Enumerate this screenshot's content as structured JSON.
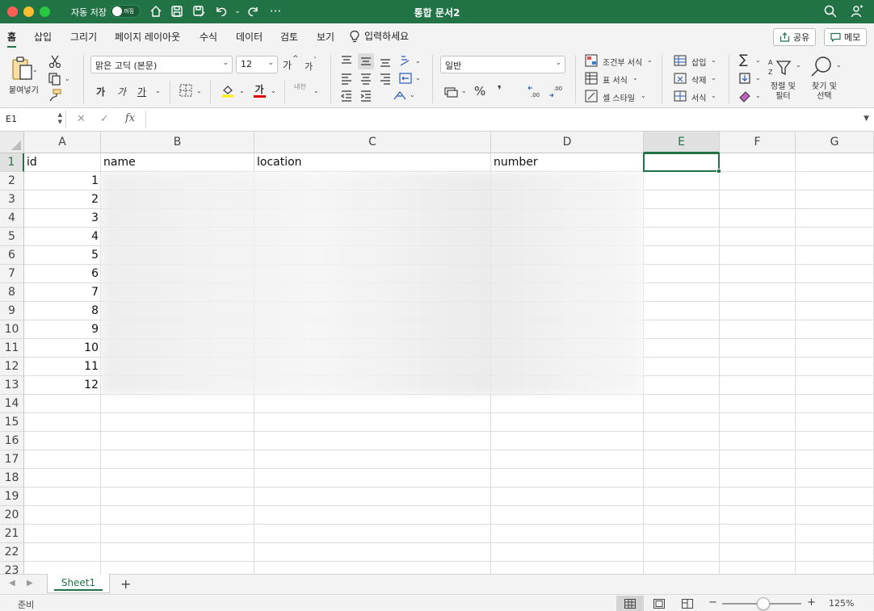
{
  "window": {
    "title": "통합 문서2",
    "autosave_label": "자동 저장",
    "autosave_state": "꺼짐"
  },
  "tabs": [
    "홈",
    "삽입",
    "그리기",
    "페이지 레이아웃",
    "수식",
    "데이터",
    "검토",
    "보기"
  ],
  "tell_me": "입력하세요",
  "share_label": "공유",
  "memo_label": "메모",
  "ribbon": {
    "paste_label": "붙여넣기",
    "font_name": "맑은 고딕 (본문)",
    "font_size": "12",
    "grow_font": "가",
    "shrink_font": "가",
    "bold": "가",
    "italic": "가",
    "underline": "가",
    "font_color_glyph": "가",
    "phonetic": "내천",
    "number_format": "일반",
    "percent": "%",
    "comma": "❜",
    "conditional_format": "조건부 서식",
    "format_as_table": "표 서식",
    "cell_styles": "셀 스타일",
    "insert": "삽입",
    "delete": "삭제",
    "format": "서식",
    "sort_filter": "정렬 및\n필터",
    "find_select": "찾기 및\n선택",
    "colors": {
      "font_color": "#e00000",
      "highlight": "#ffee00",
      "accent": "#217346"
    }
  },
  "formula_bar": {
    "name_box": "E1",
    "fx": "fx",
    "content": ""
  },
  "grid": {
    "columns": [
      "A",
      "B",
      "C",
      "D",
      "E",
      "F",
      "G"
    ],
    "rows": [
      "1",
      "2",
      "3",
      "4",
      "5",
      "6",
      "7",
      "8",
      "9",
      "10",
      "11",
      "12",
      "13",
      "14",
      "15",
      "16",
      "17",
      "18",
      "19",
      "20",
      "21",
      "22",
      "23"
    ],
    "header_row": [
      "id",
      "name",
      "location",
      "number"
    ],
    "id_values": [
      "1",
      "2",
      "3",
      "4",
      "5",
      "6",
      "7",
      "8",
      "9",
      "10",
      "11",
      "12"
    ],
    "selected_cell": "E1"
  },
  "sheet_tabs": [
    "Sheet1"
  ],
  "status": {
    "ready": "준비",
    "zoom": "125%"
  }
}
